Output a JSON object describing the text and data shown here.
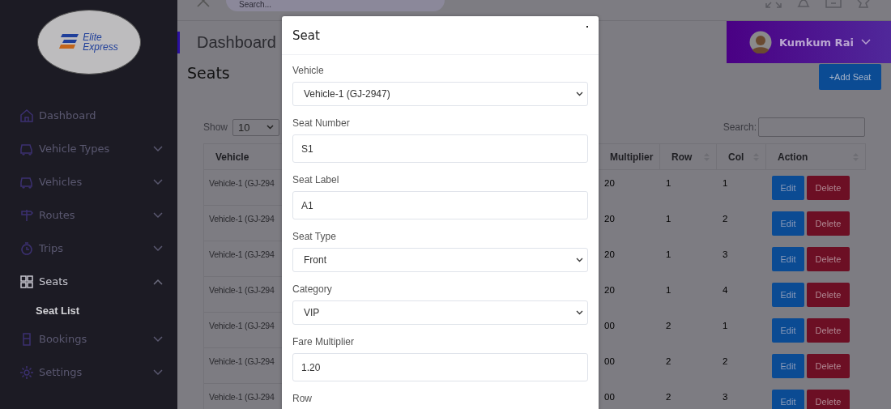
{
  "logo": {
    "line_1": "Elite",
    "line_2": "Express"
  },
  "sidebar": {
    "items": [
      {
        "kind": "link",
        "label": "Dashboard",
        "selected": false
      },
      {
        "kind": "group",
        "label": "Vehicle Types",
        "expanded": false,
        "selected": false
      },
      {
        "kind": "group",
        "label": "Vehicles",
        "expanded": false,
        "selected": false
      },
      {
        "kind": "group",
        "label": "Routes",
        "expanded": false,
        "selected": false
      },
      {
        "kind": "group",
        "label": "Trips",
        "expanded": false,
        "selected": false
      },
      {
        "kind": "group",
        "label": "Seats",
        "expanded": true,
        "selected": true,
        "children": [
          {
            "label": "Seat List",
            "selected": true
          }
        ]
      },
      {
        "kind": "group",
        "label": "Bookings",
        "expanded": false,
        "selected": false
      },
      {
        "kind": "group",
        "label": "Settings",
        "expanded": false,
        "selected": false
      }
    ]
  },
  "topbar": {
    "search_placeholder": "Search..."
  },
  "breadcrumb": "Dashboard",
  "user": {
    "name": "Kumkum Rai"
  },
  "page_title": "Seats",
  "add_button": "+Add Seat",
  "show": {
    "label": "Show",
    "value": "10"
  },
  "search_label": "Search:",
  "table": {
    "columns": [
      "Vehicle",
      "",
      "Multiplier",
      "Row",
      "Col",
      "Action"
    ],
    "rows": [
      {
        "vehicle": "Vehicle-1 (GJ-294",
        "multiplier": "20",
        "row": "1",
        "col": "1",
        "edit": "Edit",
        "delete": "Delete"
      },
      {
        "vehicle": "Vehicle-1 (GJ-294",
        "multiplier": "20",
        "row": "1",
        "col": "2",
        "edit": "Edit",
        "delete": "Delete"
      },
      {
        "vehicle": "Vehicle-1 (GJ-294",
        "multiplier": "20",
        "row": "1",
        "col": "3",
        "edit": "Edit",
        "delete": "Delete"
      },
      {
        "vehicle": "Vehicle-1 (GJ-294",
        "multiplier": "20",
        "row": "1",
        "col": "4",
        "edit": "Edit",
        "delete": "Delete"
      },
      {
        "vehicle": "Vehicle-1 (GJ-294",
        "multiplier": "00",
        "row": "2",
        "col": "1",
        "edit": "Edit",
        "delete": "Delete"
      },
      {
        "vehicle": "Vehicle-1 (GJ-294",
        "multiplier": "00",
        "row": "2",
        "col": "2",
        "edit": "Edit",
        "delete": "Delete"
      },
      {
        "vehicle": "Vehicle-1 (GJ-294",
        "multiplier": "00",
        "row": "2",
        "col": "3",
        "edit": "Edit",
        "delete": "Delete"
      }
    ]
  },
  "modal": {
    "title": "Seat",
    "fields": [
      {
        "kind": "select",
        "label": "Vehicle",
        "value": "Vehicle-1 (GJ-2947)"
      },
      {
        "kind": "input",
        "label": "Seat Number",
        "value": "S1"
      },
      {
        "kind": "input",
        "label": "Seat Label",
        "value": "A1"
      },
      {
        "kind": "select",
        "label": "Seat Type",
        "value": "Front"
      },
      {
        "kind": "select",
        "label": "Category",
        "value": "VIP"
      },
      {
        "kind": "input",
        "label": "Fare Multiplier",
        "value": "1.20"
      },
      {
        "kind": "label",
        "label": "Row"
      }
    ]
  }
}
